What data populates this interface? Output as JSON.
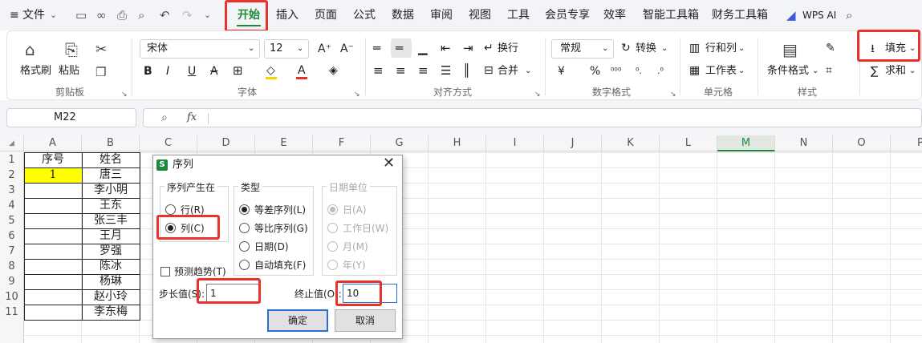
{
  "menubar": {
    "hamburger": "≡",
    "file_label": "文件",
    "tabs": [
      "开始",
      "插入",
      "页面",
      "公式",
      "数据",
      "审阅",
      "视图",
      "工具",
      "会员专享",
      "效率",
      "智能工具箱",
      "财务工具箱"
    ],
    "wps_ai": "WPS AI"
  },
  "ribbon": {
    "clipboard": {
      "format_painter": "格式刷",
      "paste": "粘贴",
      "group": "剪贴板"
    },
    "font": {
      "name": "宋体",
      "size": "12",
      "group": "字体"
    },
    "align": {
      "wrap": "换行",
      "merge": "合并",
      "group": "对齐方式"
    },
    "number": {
      "format": "常规",
      "convert": "转换",
      "group": "数字格式"
    },
    "cells": {
      "rows_cols": "行和列",
      "sheet": "工作表",
      "group": "单元格"
    },
    "styles": {
      "conditional": "条件格式",
      "group": "样式"
    },
    "edit": {
      "fill": "填充",
      "sum": "求和"
    }
  },
  "formula_bar": {
    "name_box": "M22",
    "fx": "fx"
  },
  "sheet": {
    "columns": [
      "A",
      "B",
      "C",
      "D",
      "E",
      "F",
      "G",
      "H",
      "I",
      "J",
      "K",
      "L",
      "M",
      "N",
      "O",
      "P"
    ],
    "rows": [
      "1",
      "2",
      "3",
      "4",
      "5",
      "6",
      "7",
      "8",
      "9",
      "10",
      "11"
    ],
    "col_a": [
      "序号",
      "1",
      "",
      "",
      "",
      "",
      "",
      "",
      "",
      "",
      ""
    ],
    "col_b": [
      "姓名",
      "唐三",
      "李小明",
      "王东",
      "张三丰",
      "王月",
      "罗强",
      "陈冰",
      "杨琳",
      "赵小玲",
      "李东梅"
    ],
    "highlight_color": "#ffff00",
    "active_column": "M"
  },
  "dialog": {
    "title": "序列",
    "group_series_in": "序列产生在",
    "opt_rows": "行(R)",
    "opt_cols": "列(C)",
    "group_type": "类型",
    "type_linear": "等差序列(L)",
    "type_growth": "等比序列(G)",
    "type_date": "日期(D)",
    "type_autofill": "自动填充(F)",
    "group_date_unit": "日期单位",
    "unit_day": "日(A)",
    "unit_weekday": "工作日(W)",
    "unit_month": "月(M)",
    "unit_year": "年(Y)",
    "trend": "预测趋势(T)",
    "step_label": "步长值(S):",
    "step_value": "1",
    "stop_label": "终止值(O):",
    "stop_value": "10",
    "ok": "确定",
    "cancel": "取消"
  },
  "colors": {
    "accent_red": "#e8322a",
    "active_tab": "#1d8a3a",
    "ok_border": "#2a6fd6"
  }
}
